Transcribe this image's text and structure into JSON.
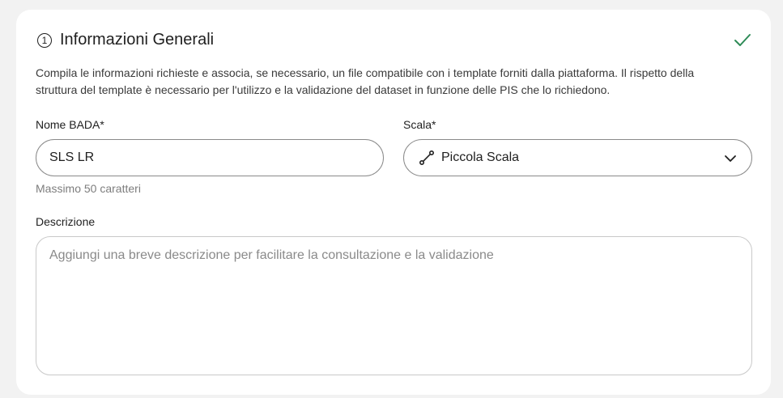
{
  "section": {
    "step_number": "1",
    "title": "Informazioni Generali",
    "status_icon": "check-icon",
    "status_color": "#2e8b57",
    "description": "Compila le informazioni richieste e associa, se necessario, un file compatibile con i template forniti dalla piattaforma. Il rispetto della struttura del template è necessario per l'utilizzo e la validazione del dataset in funzione delle PIS che lo richiedono."
  },
  "fields": {
    "nome": {
      "label": "Nome BADA*",
      "value": "SLS LR",
      "hint": "Massimo 50 caratteri"
    },
    "scala": {
      "label": "Scala*",
      "selected": "Piccola Scala",
      "icon": "route-icon"
    },
    "descrizione": {
      "label": "Descrizione",
      "value": "",
      "placeholder": "Aggiungi una breve descrizione per facilitare la consultazione e la validazione"
    }
  }
}
